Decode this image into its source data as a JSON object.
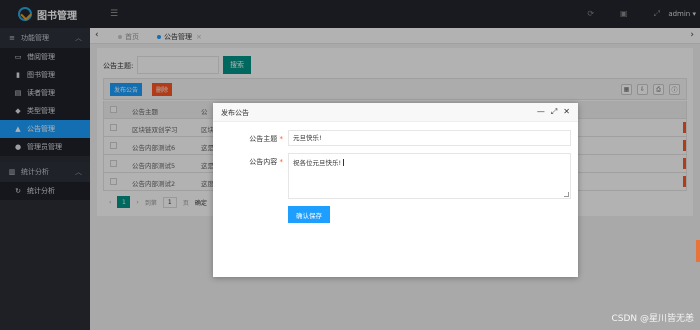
{
  "app": {
    "title": "图书管理",
    "user": "admin"
  },
  "sidebar": {
    "groups": [
      {
        "label": "功能管理",
        "items": [
          {
            "label": "借阅管理",
            "icon": "calendar-icon"
          },
          {
            "label": "图书管理",
            "icon": "book-icon"
          },
          {
            "label": "读者管理",
            "icon": "card-icon"
          },
          {
            "label": "类型管理",
            "icon": "tag-icon"
          },
          {
            "label": "公告管理",
            "icon": "bell-icon",
            "active": true
          },
          {
            "label": "管理员管理",
            "icon": "user-icon"
          }
        ]
      },
      {
        "label": "统计分析",
        "items": [
          {
            "label": "统计分析",
            "icon": "refresh-icon"
          }
        ]
      }
    ]
  },
  "tabs": [
    {
      "label": "首页"
    },
    {
      "label": "公告管理",
      "active": true,
      "close": "×"
    }
  ],
  "search": {
    "label": "公告主题:",
    "button": "搜索"
  },
  "toolbar": {
    "add": "发布公告",
    "delete": "删除"
  },
  "table": {
    "headers": [
      "公告主题",
      "公"
    ],
    "rows": [
      [
        "区块链双创学习",
        "区块"
      ],
      [
        "公告内部测试6",
        "这是"
      ],
      [
        "公告内部测试5",
        "这是"
      ],
      [
        "公告内部测试2",
        "这度"
      ]
    ]
  },
  "pager": {
    "current": "1",
    "goto_label": "到第",
    "page_value": "1",
    "page_suffix": "页",
    "confirm": "确定"
  },
  "dialog": {
    "title": "发布公告",
    "subject_label": "公告主题",
    "subject_value": "元旦快乐!",
    "content_label": "公告内容",
    "content_value": "祝各位元旦快乐!",
    "submit": "确认保存"
  },
  "watermark": "CSDN @星川皆无恙",
  "colors": {
    "primary": "#1e9fff",
    "teal": "#009688",
    "danger": "#ff5722",
    "header_bg": "#23262e",
    "sidebar_bg": "#2b2e37"
  }
}
